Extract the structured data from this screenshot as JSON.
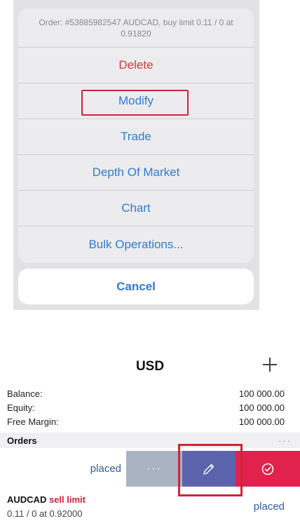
{
  "action_sheet": {
    "header": "Order: #53885982547 AUDCAD, buy limit 0.11 / 0 at 0.91820",
    "items": [
      {
        "label": "Delete"
      },
      {
        "label": "Modify"
      },
      {
        "label": "Trade"
      },
      {
        "label": "Depth Of Market"
      },
      {
        "label": "Chart"
      },
      {
        "label": "Bulk Operations..."
      }
    ],
    "cancel_label": "Cancel",
    "colors": {
      "action": "#2f7bd3",
      "destructive": "#d33a3a",
      "highlight": "#d0233a"
    }
  },
  "trade": {
    "currency": "USD",
    "balance_label": "Balance:",
    "balance_value": "100 000.00",
    "equity_label": "Equity:",
    "equity_value": "100 000.00",
    "free_margin_label": "Free Margin:",
    "free_margin_value": "100 000.00",
    "orders_title": "Orders",
    "orders_more": "···",
    "swipe_placed": "placed",
    "swipe_more": "···",
    "order": {
      "symbol": "AUDCAD",
      "kind": "sell limit",
      "detail": "0.11 / 0 at 0.92000",
      "status": "placed"
    },
    "colors": {
      "more_action": "#a9b3c2",
      "edit_action": "#5d62ad",
      "confirm_action": "#e0224d",
      "sell": "#d0233a"
    }
  }
}
